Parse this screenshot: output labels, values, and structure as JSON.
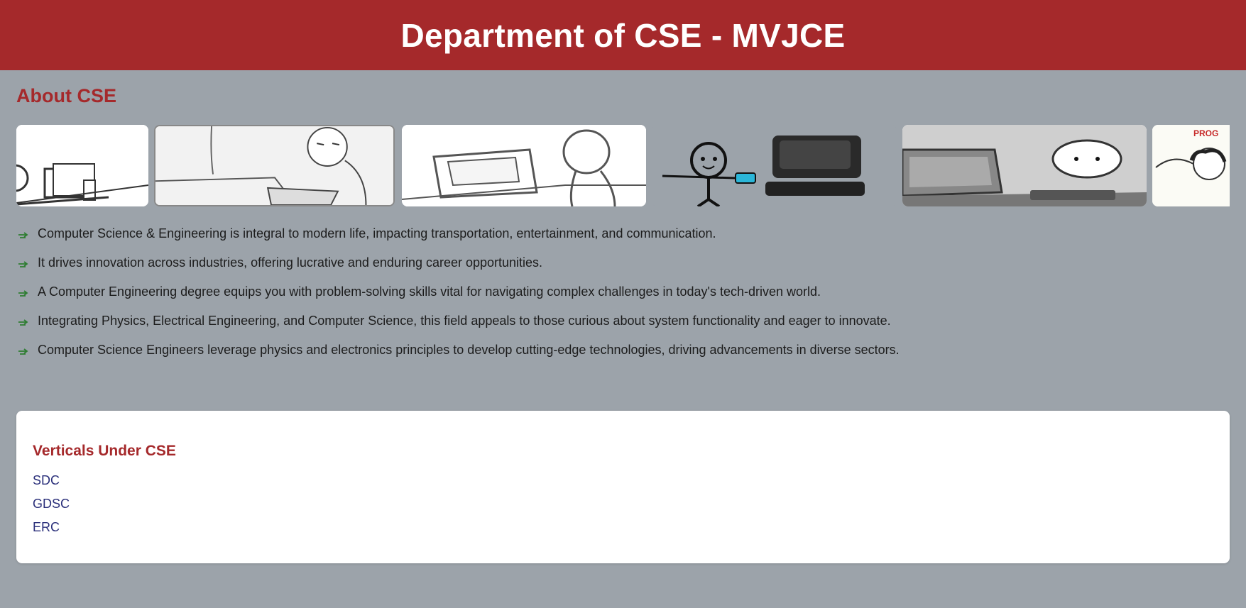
{
  "header": {
    "title": "Department of CSE - MVJCE"
  },
  "about": {
    "title": "About CSE",
    "gallery": [
      {
        "icon": "comic-person-at-desk-image"
      },
      {
        "icon": "comic-typing-person-image"
      },
      {
        "icon": "comic-person-with-laptop-image"
      },
      {
        "icon": "comic-stick-figure-with-computer-image"
      },
      {
        "icon": "comic-person-at-monitor-image"
      },
      {
        "icon": "comic-programmer-image"
      }
    ],
    "points": [
      "Computer Science & Engineering is integral to modern life, impacting transportation, entertainment, and communication.",
      "It drives innovation across industries, offering lucrative and enduring career opportunities.",
      "A Computer Engineering degree equips you with problem-solving skills vital for navigating complex challenges in today's tech-driven world.",
      "Integrating Physics, Electrical Engineering, and Computer Science, this field appeals to those curious about system functionality and eager to innovate.",
      "Computer Science Engineers leverage physics and electronics principles to develop cutting-edge technologies, driving advancements in diverse sectors."
    ],
    "bullet_icon": "arrow-bullet-icon"
  },
  "verticals": {
    "title": "Verticals Under CSE",
    "items": [
      "SDC",
      "GDSC",
      "ERC"
    ]
  },
  "gallery_partial_text": "PROG",
  "colors": {
    "header_bg": "#a5292b",
    "page_bg": "#9ca3aa",
    "accent": "#a5292b",
    "link": "#2a2f7a",
    "bullet": "#2e7d32"
  }
}
